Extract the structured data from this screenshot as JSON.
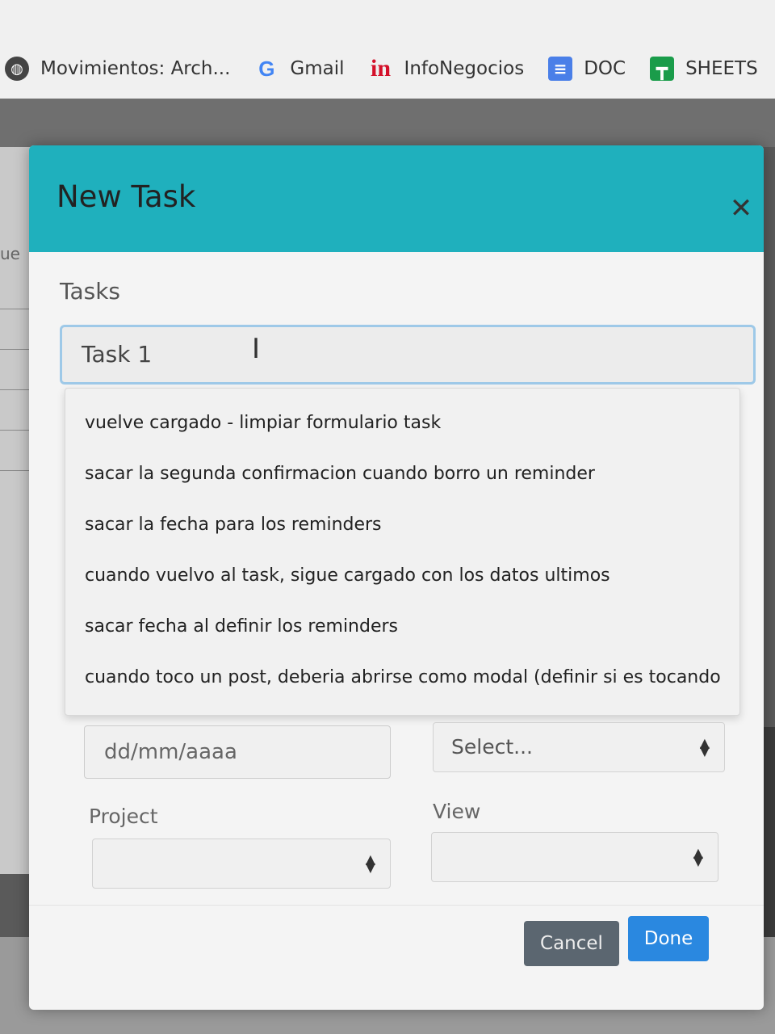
{
  "bookmarks": [
    {
      "label": "Movimientos: Arch...",
      "icon": "globe-icon"
    },
    {
      "label": "Gmail",
      "icon": "google-icon"
    },
    {
      "label": "InfoNegocios",
      "icon": "infonegocios-icon"
    },
    {
      "label": "DOC",
      "icon": "docs-icon"
    },
    {
      "label": "SHEETS",
      "icon": "sheets-icon"
    }
  ],
  "background": {
    "side_text": "ue"
  },
  "modal": {
    "title": "New Task",
    "close_symbol": "✕",
    "tasks_label": "Tasks",
    "task_value": "Task 1",
    "suggestions": [
      "vuelve cargado - limpiar formulario task",
      "sacar la segunda confirmacion cuando borro un reminder",
      "sacar la fecha para los reminders",
      "cuando vuelvo al task, sigue cargado con los datos ultimos",
      "sacar fecha  al definir los reminders",
      "cuando toco un post, deberia abrirse como modal  (definir si es tocando e"
    ],
    "date_placeholder": "dd/mm/aaaa",
    "select_placeholder": "Select...",
    "project_label": "Project",
    "project_value": "",
    "view_label": "View",
    "view_value": "",
    "cancel_label": "Cancel",
    "done_label": "Done"
  },
  "colors": {
    "header": "#1fb0bd",
    "done_button": "#2a88e0",
    "cancel_button": "#5b6670"
  }
}
